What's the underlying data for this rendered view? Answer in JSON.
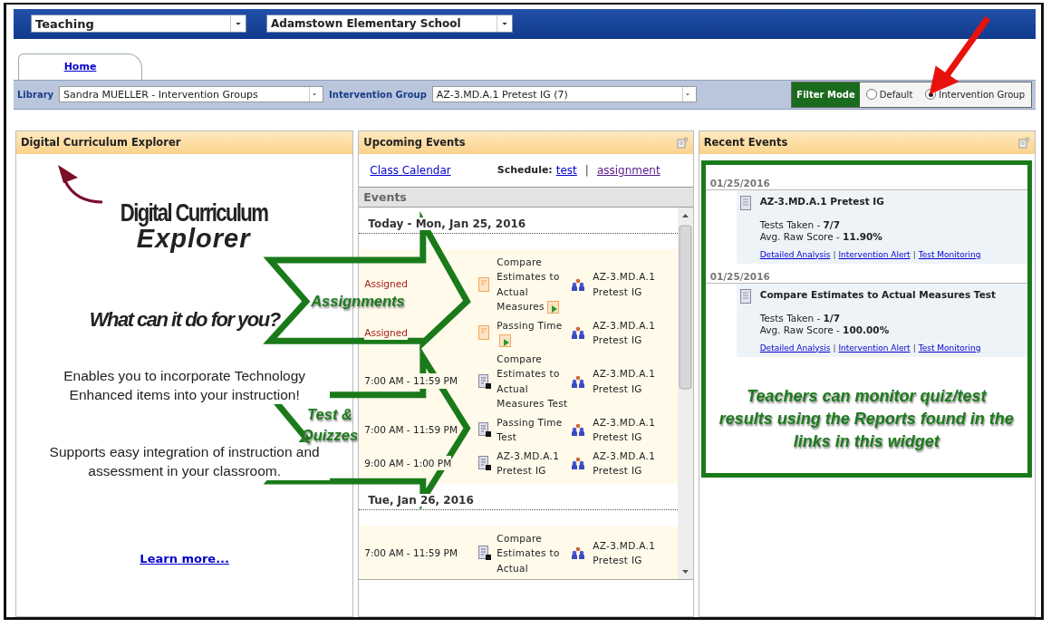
{
  "top_bar": {
    "role_select": "Teaching",
    "school_select": "Adamstown Elementary School"
  },
  "tabs": [
    {
      "label": "Home",
      "selected": true
    }
  ],
  "filter_bar": {
    "library_label": "Library",
    "library_value": "Sandra MUELLER - Intervention Groups",
    "group_label": "Intervention Group",
    "group_value": "AZ-3.MD.A.1 Pretest IG (7)",
    "filter_mode_label": "Filter Mode",
    "modes": [
      {
        "label": "Default",
        "selected": false
      },
      {
        "label": "Intervention Group",
        "selected": true
      }
    ]
  },
  "curriculum_panel": {
    "title": "Digital Curriculum Explorer",
    "logo_line_1": "Digital Curriculum",
    "logo_line_2": "Explorer",
    "tagline": "What can it do for you?",
    "paragraphs": [
      "Enables you to incorporate Technology Enhanced items into your instruction!",
      "Supports easy integration of instruction and assessment in your classroom."
    ],
    "link": "Learn more..."
  },
  "upcoming_panel": {
    "title": "Upcoming Events",
    "calendar_link": "Class Calendar",
    "schedule_label": "Schedule:",
    "schedule_links": [
      "test",
      "assignment"
    ],
    "separator": "|",
    "events_heading": "Events",
    "days": [
      {
        "label": "Today - Mon, Jan 25, 2016",
        "events": [
          {
            "kind": "assignment",
            "when": "Assigned",
            "title": "Compare Estimates to Actual Measures",
            "group": "AZ-3.MD.A.1 Pretest IG"
          },
          {
            "kind": "assignment",
            "when": "Assigned",
            "title": "Passing Time",
            "group": "AZ-3.MD.A.1 Pretest IG"
          },
          {
            "kind": "test",
            "when": "7:00 AM - 11:59 PM",
            "title": "Compare Estimates to Actual Measures Test",
            "group": "AZ-3.MD.A.1 Pretest IG"
          },
          {
            "kind": "test",
            "when": "7:00 AM - 11:59 PM",
            "title": "Passing Time Test",
            "group": "AZ-3.MD.A.1 Pretest IG"
          },
          {
            "kind": "test",
            "when": "9:00 AM - 1:00 PM",
            "title": "AZ-3.MD.A.1 Pretest IG",
            "group": "AZ-3.MD.A.1 Pretest IG"
          }
        ]
      },
      {
        "label": "Tue, Jan 26, 2016",
        "events": [
          {
            "kind": "test",
            "when": "7:00 AM - 11:59 PM",
            "title": "Compare Estimates to Actual",
            "group": "AZ-3.MD.A.1 Pretest IG"
          }
        ]
      }
    ]
  },
  "recent_panel": {
    "title": "Recent Events",
    "separator": "|",
    "entries": [
      {
        "date": "01/25/2016",
        "title": "AZ-3.MD.A.1 Pretest IG",
        "tests_taken_label": "Tests Taken -",
        "tests_taken": "7/7",
        "score_label": "Avg. Raw Score -",
        "score": "11.90%",
        "links": [
          "Detailed Analysis",
          "Intervention Alert",
          "Test Monitoring"
        ]
      },
      {
        "date": "01/25/2016",
        "title": "Compare Estimates to Actual Measures Test",
        "tests_taken_label": "Tests Taken -",
        "tests_taken": "1/7",
        "score_label": "Avg. Raw Score -",
        "score": "100.00%",
        "links": [
          "Detailed Analysis",
          "Intervention Alert",
          "Test Monitoring"
        ]
      }
    ],
    "note": "Teachers can monitor quiz/test results using the Reports found in the links in this widget"
  },
  "annotations": [
    "Assignments",
    "Test & Quizzes"
  ]
}
